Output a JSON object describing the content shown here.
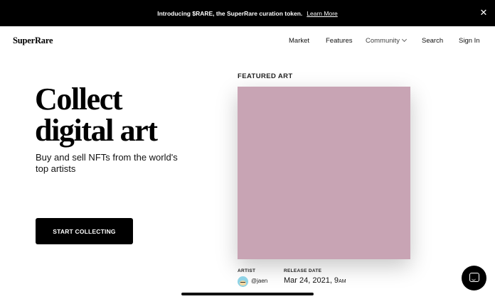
{
  "promo": {
    "text": "Introducing $RARE, the SuperRare curation token.",
    "link": "Learn More",
    "close": "✕"
  },
  "nav": {
    "logo": "SuperRare",
    "items": [
      "Market",
      "Features",
      "Community",
      "Search",
      "Sign In"
    ]
  },
  "hero": {
    "title_line1": "Collect",
    "title_line2": "digital art",
    "subtitle": "Buy and sell NFTs from the world's top artists",
    "cta": "START COLLECTING"
  },
  "featured": {
    "label": "FEATURED ART",
    "art_color": "#c8a4b4",
    "artist_label": "ARTIST",
    "artist_handle": "@jaen",
    "release_label": "RELEASE DATE",
    "release_date": "Mar 24, 2021, 9",
    "release_ampm": "AM"
  },
  "widgets": {
    "chat_icon": "chat-icon"
  }
}
